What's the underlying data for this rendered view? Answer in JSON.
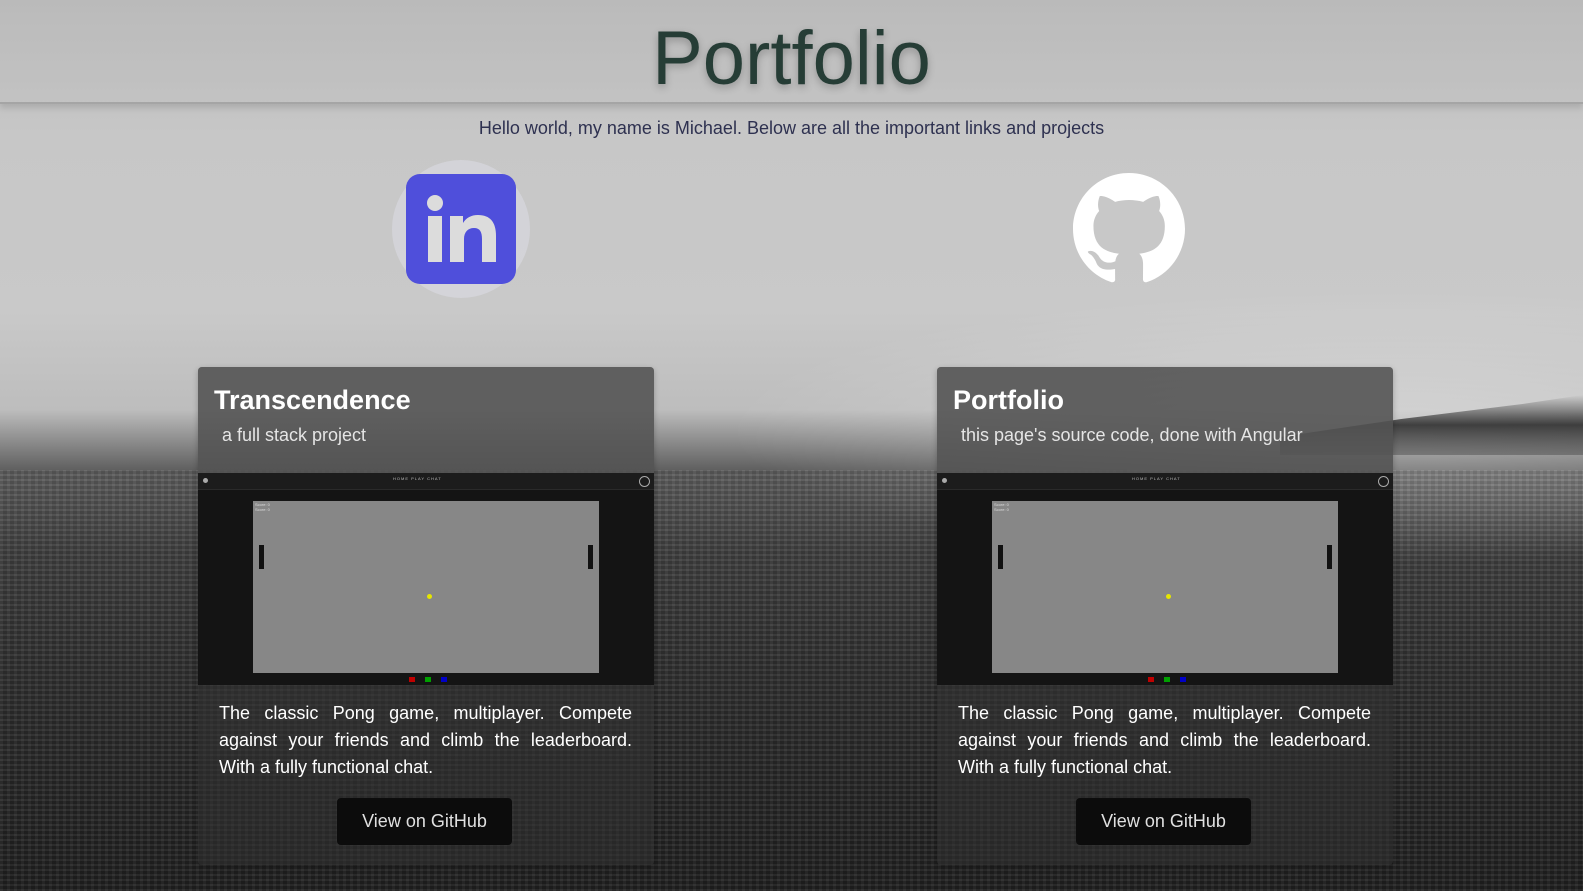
{
  "header": {
    "title": "Portfolio",
    "intro": "Hello world, my name is Michael. Below are all the important links and projects"
  },
  "social_links": [
    {
      "name": "LinkedIn",
      "icon": "linkedin-icon",
      "color": "#4f4fdb"
    },
    {
      "name": "GitHub",
      "icon": "github-icon",
      "color": "#ffffff"
    }
  ],
  "projects": [
    {
      "title": "Transcendence",
      "subtitle": "a full stack project",
      "description": "The classic Pong game, multiplayer. Compete against your friends and climb the leaderboard. With a fully functional chat.",
      "button_label": "View on GitHub",
      "screenshot": {
        "nav_links": "HOME  PLAY  CHAT",
        "score_lines": [
          "Score: 0",
          "Score: 0"
        ],
        "ball_color": "#e6e600",
        "swatches": [
          "#c00000",
          "#00a000",
          "#0000c8"
        ]
      }
    },
    {
      "title": "Portfolio",
      "subtitle": "this page's source code, done with Angular",
      "description": "The classic Pong game, multiplayer. Compete against your friends and climb the leaderboard. With a fully functional chat.",
      "button_label": "View on GitHub",
      "screenshot": {
        "nav_links": "HOME  PLAY  CHAT",
        "score_lines": [
          "Score: 0",
          "Score: 0"
        ],
        "ball_color": "#e6e600",
        "swatches": [
          "#c00000",
          "#00a000",
          "#0000c8"
        ]
      }
    }
  ]
}
